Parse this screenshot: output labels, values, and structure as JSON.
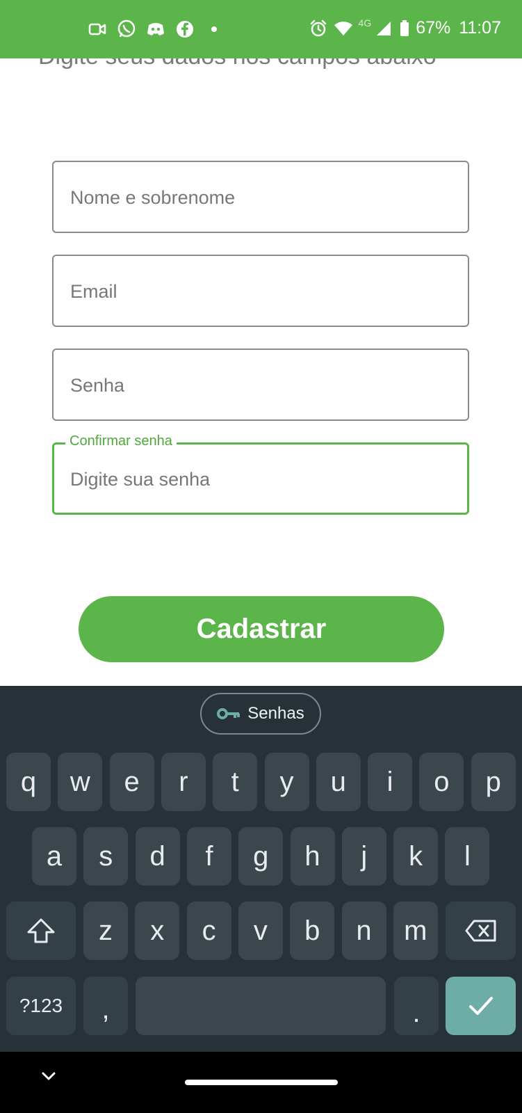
{
  "status_bar": {
    "battery_percent": "67%",
    "time": "11:07",
    "network": "4G",
    "left_icons": [
      "video-call-icon",
      "whatsapp-icon",
      "discord-icon",
      "facebook-icon",
      "notification-dot-icon"
    ],
    "right_icons": [
      "alarm-icon",
      "wifi-icon",
      "signal-icon",
      "battery-icon"
    ]
  },
  "form": {
    "subtitle": "Digite seus dados nos campos abaixo",
    "name_placeholder": "Nome e sobrenome",
    "email_placeholder": "Email",
    "password_placeholder": "Senha",
    "confirm_label": "Confirmar senha",
    "confirm_placeholder": "Digite sua senha",
    "submit_label": "Cadastrar"
  },
  "keyboard": {
    "suggestion_chip": "Senhas",
    "row1": [
      "q",
      "w",
      "e",
      "r",
      "t",
      "y",
      "u",
      "i",
      "o",
      "p"
    ],
    "row2": [
      "a",
      "s",
      "d",
      "f",
      "g",
      "h",
      "j",
      "k",
      "l"
    ],
    "row3": [
      "z",
      "x",
      "c",
      "v",
      "b",
      "n",
      "m"
    ],
    "symbols_label": "?123",
    "comma_label": ",",
    "period_label": "."
  },
  "colors": {
    "accent": "#5cb54a",
    "keyboard_bg": "#263238",
    "key_bg": "#3b464d",
    "enter_key": "#6dada6"
  }
}
